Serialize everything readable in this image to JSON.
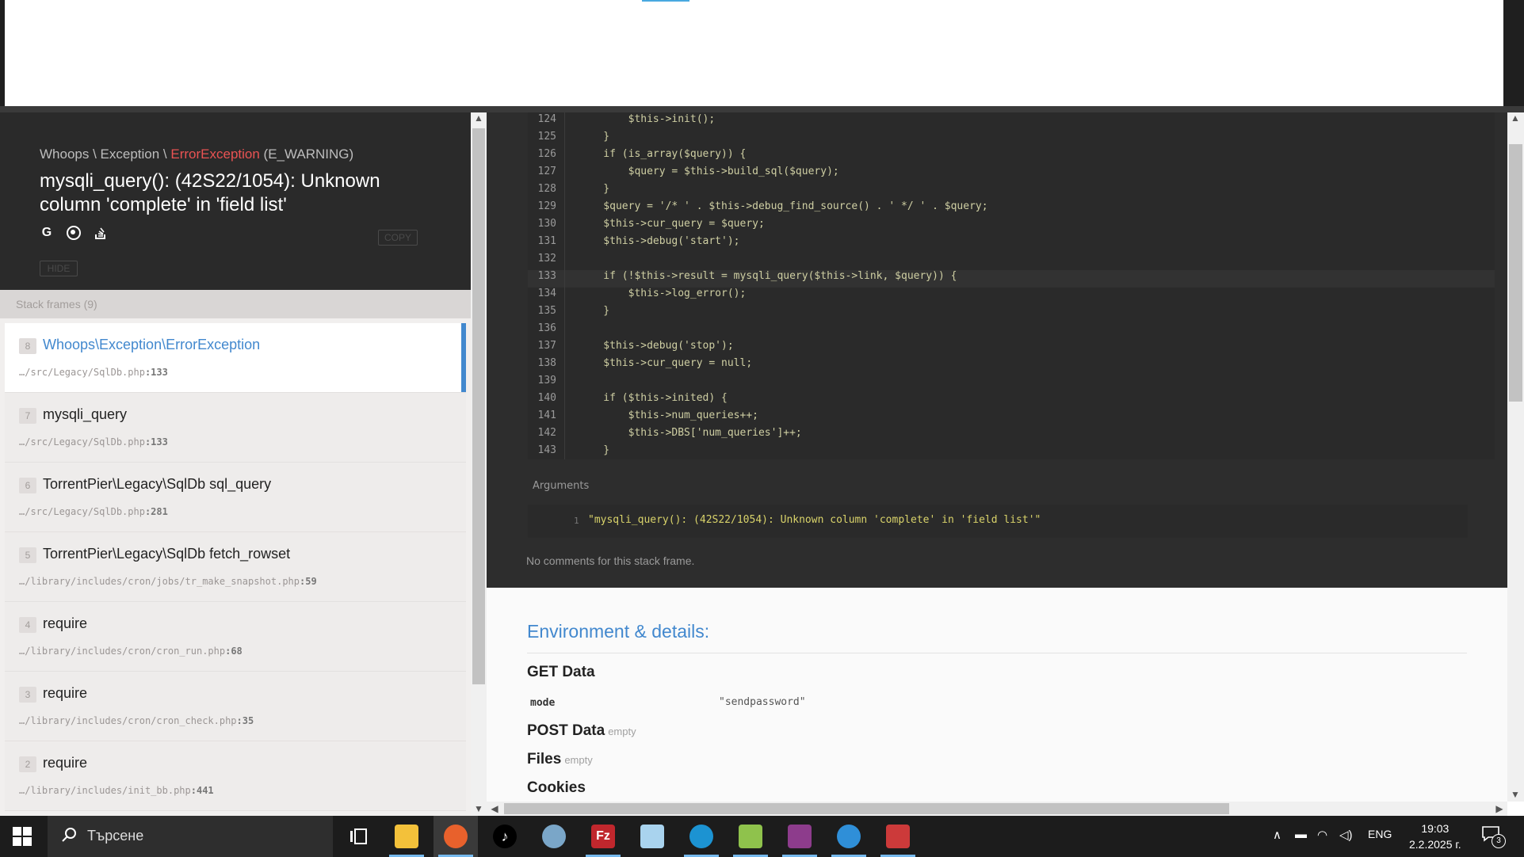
{
  "exception": {
    "breadcrumb_prefix": "Whoops \\ Exception \\ ",
    "breadcrumb_error": "ErrorException",
    "breadcrumb_suffix": " (E_WARNING)",
    "message": "mysqli_query(): (42S22/1054): Unknown column 'complete' in 'field list'",
    "copy_label": "COPY",
    "hide_label": "HIDE",
    "icons": [
      "google-icon",
      "duckduckgo-icon",
      "stackoverflow-icon"
    ]
  },
  "frames": {
    "label": "Stack frames (9)",
    "items": [
      {
        "index": "8",
        "class": "Whoops\\Exception\\ErrorException",
        "file": "…/src/Legacy/SqlDb.php",
        "line": ":133"
      },
      {
        "index": "7",
        "class": "mysqli_query",
        "file": "…/src/Legacy/SqlDb.php",
        "line": ":133"
      },
      {
        "index": "6",
        "class": "TorrentPier\\Legacy\\SqlDb sql_query",
        "file": "…/src/Legacy/SqlDb.php",
        "line": ":281"
      },
      {
        "index": "5",
        "class": "TorrentPier\\Legacy\\SqlDb fetch_rowset",
        "file": "…/library/includes/cron/jobs/tr_make_snapshot.php",
        "line": ":59"
      },
      {
        "index": "4",
        "class": "require",
        "file": "…/library/includes/cron/cron_run.php",
        "line": ":68"
      },
      {
        "index": "3",
        "class": "require",
        "file": "…/library/includes/cron/cron_check.php",
        "line": ":35"
      },
      {
        "index": "2",
        "class": "require",
        "file": "…/library/includes/init_bb.php",
        "line": ":441"
      }
    ]
  },
  "code": {
    "lines": [
      {
        "n": "124",
        "t": "        $this->init();"
      },
      {
        "n": "125",
        "t": "    }"
      },
      {
        "n": "126",
        "t": "    if (is_array($query)) {"
      },
      {
        "n": "127",
        "t": "        $query = $this->build_sql($query);"
      },
      {
        "n": "128",
        "t": "    }"
      },
      {
        "n": "129",
        "t": "    $query = '/* ' . $this->debug_find_source() . ' */ ' . $query;"
      },
      {
        "n": "130",
        "t": "    $this->cur_query = $query;"
      },
      {
        "n": "131",
        "t": "    $this->debug('start');"
      },
      {
        "n": "132",
        "t": ""
      },
      {
        "n": "133",
        "t": "    if (!$this->result = mysqli_query($this->link, $query)) {"
      },
      {
        "n": "134",
        "t": "        $this->log_error();"
      },
      {
        "n": "135",
        "t": "    }"
      },
      {
        "n": "136",
        "t": ""
      },
      {
        "n": "137",
        "t": "    $this->debug('stop');"
      },
      {
        "n": "138",
        "t": "    $this->cur_query = null;"
      },
      {
        "n": "139",
        "t": ""
      },
      {
        "n": "140",
        "t": "    if ($this->inited) {"
      },
      {
        "n": "141",
        "t": "        $this->num_queries++;"
      },
      {
        "n": "142",
        "t": "        $this->DBS['num_queries']++;"
      },
      {
        "n": "143",
        "t": "    }"
      }
    ],
    "highlight_line": "133",
    "arguments_label": "Arguments",
    "argument_index": "1",
    "argument_value": "\"mysqli_query(): (42S22/1054): Unknown column 'complete' in 'field list'\"",
    "no_comments": "No comments for this stack frame."
  },
  "environment": {
    "title": "Environment & details:",
    "get_label": "GET Data",
    "get_key": "mode",
    "get_value": "\"sendpassword\"",
    "post_label": "POST Data",
    "post_empty": "empty",
    "files_label": "Files",
    "files_empty": "empty",
    "cookies_label": "Cookies"
  },
  "taskbar": {
    "search_placeholder": "Търсене",
    "apps": [
      "task-view-icon",
      "file-explorer-icon",
      "firefox-icon",
      "tiktok-icon",
      "app-icon",
      "filezilla-icon",
      "notepad-icon",
      "edge-icon",
      "notepadpp-icon",
      "winrar-icon",
      "cloud-icon",
      "image-viewer-icon"
    ],
    "filezilla_label": "Fz",
    "language": "ENG",
    "time": "19:03",
    "date": "2.2.2025 г.",
    "notification_count": "3"
  }
}
